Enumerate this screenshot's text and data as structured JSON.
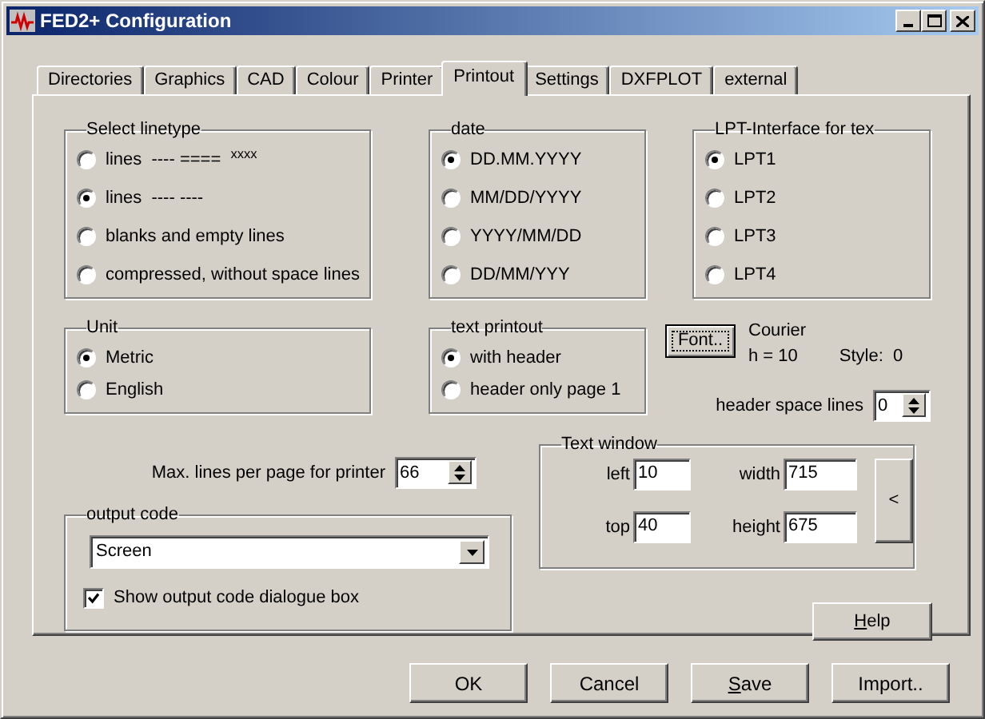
{
  "window": {
    "title": "FED2+ Configuration"
  },
  "tabs": [
    {
      "label": "Directories",
      "selected": false
    },
    {
      "label": "Graphics",
      "selected": false
    },
    {
      "label": "CAD",
      "selected": false
    },
    {
      "label": "Colour",
      "selected": false
    },
    {
      "label": "Printer",
      "selected": false
    },
    {
      "label": "Printout",
      "selected": true
    },
    {
      "label": "Settings",
      "selected": false
    },
    {
      "label": "DXFPLOT",
      "selected": false
    },
    {
      "label": "external",
      "selected": false
    }
  ],
  "linetype": {
    "title": "Select linetype",
    "options": [
      {
        "label": "lines  ---- ====  $^{xxxx}$",
        "selected": false
      },
      {
        "label": "lines  ---- ----",
        "selected": true
      },
      {
        "label": "blanks and empty lines",
        "selected": false
      },
      {
        "label": "compressed, without space lines",
        "selected": false
      }
    ]
  },
  "date": {
    "title": "date",
    "options": [
      {
        "label": "DD.MM.YYYY",
        "selected": true
      },
      {
        "label": "MM/DD/YYYY",
        "selected": false
      },
      {
        "label": "YYYY/MM/DD",
        "selected": false
      },
      {
        "label": "DD/MM/YYY",
        "selected": false
      }
    ]
  },
  "lpt": {
    "title": "LPT-Interface for tex",
    "options": [
      {
        "label": "LPT1",
        "selected": true
      },
      {
        "label": "LPT2",
        "selected": false
      },
      {
        "label": "LPT3",
        "selected": false
      },
      {
        "label": "LPT4",
        "selected": false
      }
    ]
  },
  "unit": {
    "title": "Unit",
    "options": [
      {
        "label": "Metric",
        "selected": true
      },
      {
        "label": "English",
        "selected": false
      }
    ]
  },
  "text_printout": {
    "title": "text printout",
    "options": [
      {
        "label": "with header",
        "selected": true
      },
      {
        "label": "header only page 1",
        "selected": false
      }
    ]
  },
  "font": {
    "button": "Font..",
    "name": "Courier",
    "height": "h = 10",
    "style": "Style:  0"
  },
  "header_space_lines": {
    "label": "header space lines",
    "value": "0"
  },
  "max_lines": {
    "label": "Max. lines per page for printer",
    "value": "66"
  },
  "text_window": {
    "title": "Text window",
    "fields": [
      {
        "label": "left",
        "value": "10"
      },
      {
        "label": "width",
        "value": "715"
      },
      {
        "label": "top",
        "value": "40"
      },
      {
        "label": "height",
        "value": "675"
      }
    ],
    "button": "<"
  },
  "output_code": {
    "title": "output code",
    "value": "Screen",
    "checkbox": {
      "label": "Show output code dialogue box",
      "checked": true
    }
  },
  "help_button": {
    "label": "Help",
    "mnemonic": true
  },
  "buttons": [
    {
      "label": "OK",
      "mnemonic": false
    },
    {
      "label": "Cancel",
      "mnemonic": false
    },
    {
      "label": "Save",
      "mnemonic": true
    },
    {
      "label": "Import..",
      "mnemonic": false
    }
  ]
}
